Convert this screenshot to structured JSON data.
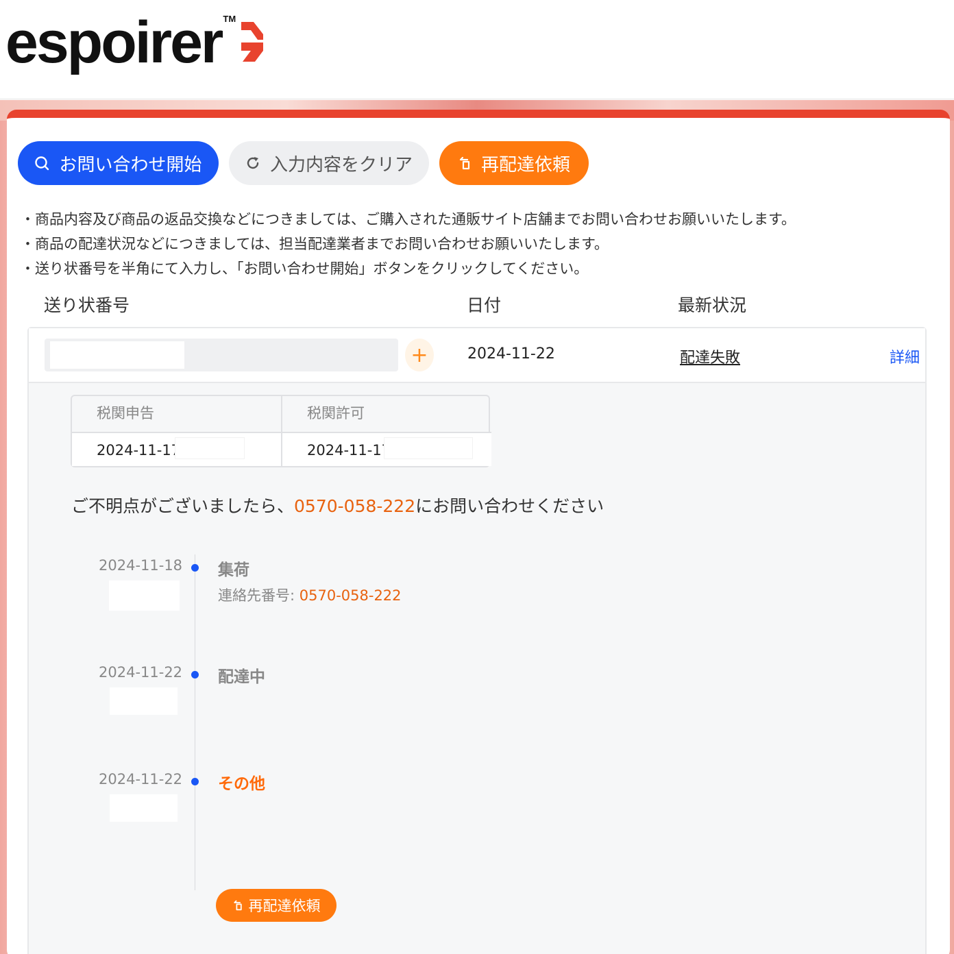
{
  "brand": {
    "name": "espoirer",
    "tm": "TM",
    "accent": "#e8432e"
  },
  "toolbar": {
    "search_label": "お問い合わせ開始",
    "search_icon": "search-icon",
    "clear_label": "入力内容をクリア",
    "clear_icon": "refresh-icon",
    "redeliver_label": "再配達依頼",
    "redeliver_icon": "redelivery-icon",
    "colors": {
      "search": "#1a57f5",
      "clear": "#eeeff1",
      "redeliver": "#ff7a0f"
    }
  },
  "notes": [
    "・商品内容及び商品の返品交換などにつきましては、ご購入された通販サイト店舗までお問い合わせお願いいたします。",
    "・商品の配達状況などにつきましては、担当配達業者までお問い合わせお願いいたします。",
    "・送り状番号を半角にて入力し、「お問い合わせ開始」ボタンをクリックしてください。"
  ],
  "table": {
    "headers": {
      "tracking": "送り状番号",
      "date": "日付",
      "status": "最新状況"
    },
    "row": {
      "tracking_value": "",
      "date": "2024-11-22",
      "status": "配達失敗",
      "detail": "詳細"
    }
  },
  "customs": {
    "declaration_label": "税関申告",
    "permission_label": "税関許可",
    "declaration_date": "2024-11-17",
    "permission_date": "2024-11-17"
  },
  "contact": {
    "prefix": "ご不明点がございましたら、",
    "phone": "0570-058-222",
    "suffix": "にお問い合わせください"
  },
  "timeline": [
    {
      "date": "2024-11-18",
      "title": "集荷",
      "sub_label": "連絡先番号: ",
      "sub_phone": "0570-058-222"
    },
    {
      "date": "2024-11-22",
      "title": "配達中"
    },
    {
      "date": "2024-11-22",
      "title": "その他"
    }
  ],
  "bottom_button": {
    "label": "再配達依頼",
    "icon": "redelivery-icon"
  }
}
